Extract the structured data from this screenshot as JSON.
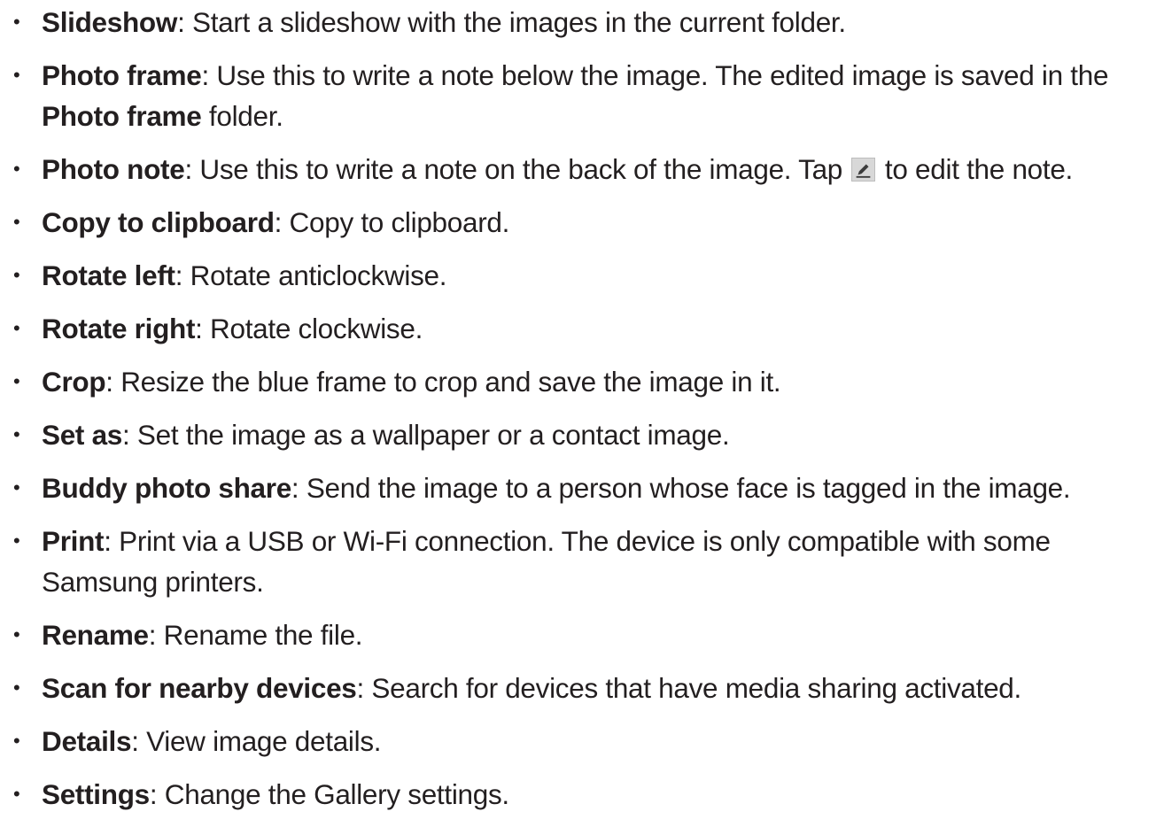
{
  "items": [
    {
      "term": "Slideshow",
      "text": ": Start a slideshow with the images in the current folder."
    },
    {
      "term": "Photo frame",
      "text": ": Use this to write a note below the image. The edited image is saved in the ",
      "term2": "Photo frame",
      "text2": " folder."
    },
    {
      "term": "Photo note",
      "text": ": Use this to write a note on the back of the image. Tap ",
      "icon": "pencil-edit-icon",
      "text2": " to edit the note."
    },
    {
      "term": "Copy to clipboard",
      "text": ": Copy to clipboard."
    },
    {
      "term": "Rotate left",
      "text": ": Rotate anticlockwise."
    },
    {
      "term": "Rotate right",
      "text": ": Rotate clockwise."
    },
    {
      "term": "Crop",
      "text": ": Resize the blue frame to crop and save the image in it."
    },
    {
      "term": "Set as",
      "text": ": Set the image as a wallpaper or a contact image."
    },
    {
      "term": "Buddy photo share",
      "text": ": Send the image to a person whose face is tagged in the image."
    },
    {
      "term": "Print",
      "text": ": Print via a USB or Wi-Fi connection. The device is only compatible with some Samsung printers."
    },
    {
      "term": "Rename",
      "text": ": Rename the file."
    },
    {
      "term": "Scan for nearby devices",
      "text": ": Search for devices that have media sharing activated."
    },
    {
      "term": "Details",
      "text": ": View image details."
    },
    {
      "term": "Settings",
      "text": ": Change the Gallery settings."
    }
  ],
  "bullet": "•"
}
